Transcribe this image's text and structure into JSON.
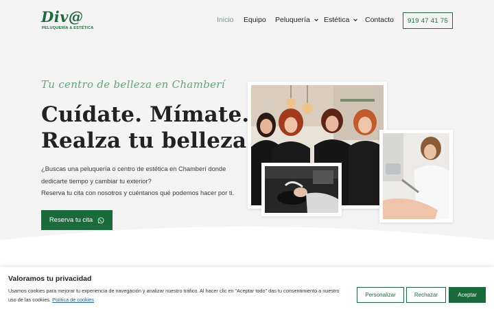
{
  "brand": {
    "logo_text": "Div@",
    "logo_subtitle": "PELUQUERÍA & ESTÉTICA",
    "primary_color": "#1a6b3c",
    "accent_color": "#5fa57b"
  },
  "nav": {
    "items": [
      {
        "label": "Inicio",
        "active": true,
        "dropdown": false
      },
      {
        "label": "Equipo",
        "active": false,
        "dropdown": false
      },
      {
        "label": "Peluquería",
        "active": false,
        "dropdown": true
      },
      {
        "label": "Estética",
        "active": false,
        "dropdown": true
      },
      {
        "label": "Contacto",
        "active": false,
        "dropdown": false
      }
    ],
    "phone": "919 47 41 75"
  },
  "hero": {
    "tagline": "Tu centro de belleza en Chamberí",
    "headline_line1": "Cuídate. Mímate.",
    "headline_line2": "Realza tu belleza.",
    "intro_line1": "¿Buscas una peluquería o centro de estética en Chamberí donde",
    "intro_line2": "dedicarte tiempo y cambiar tu exterior?",
    "intro_line3": "Reserva tu cita con nosotros y cuéntanos qué podemos hacer por ti.",
    "cta_label": "Reserva tu cita",
    "cta_icon": "whatsapp-icon"
  },
  "photos": [
    {
      "name": "team-photo"
    },
    {
      "name": "hair-wash-photo"
    },
    {
      "name": "laser-treatment-photo"
    }
  ],
  "cookie_banner": {
    "title": "Valoramos tu privacidad",
    "text_line1": "Usamos cookies para mejorar tu experiencia de navegación y analizar nuestro tráfico. Al hacer clic en \"Aceptar todo\" das tu consentimiento a nuestro uso de las",
    "text_line2_prefix": "cookies.",
    "policy_link": "Política de cookies",
    "customize_label": "Personalizar",
    "reject_label": "Rechazar",
    "accept_label": "Aceptar"
  }
}
